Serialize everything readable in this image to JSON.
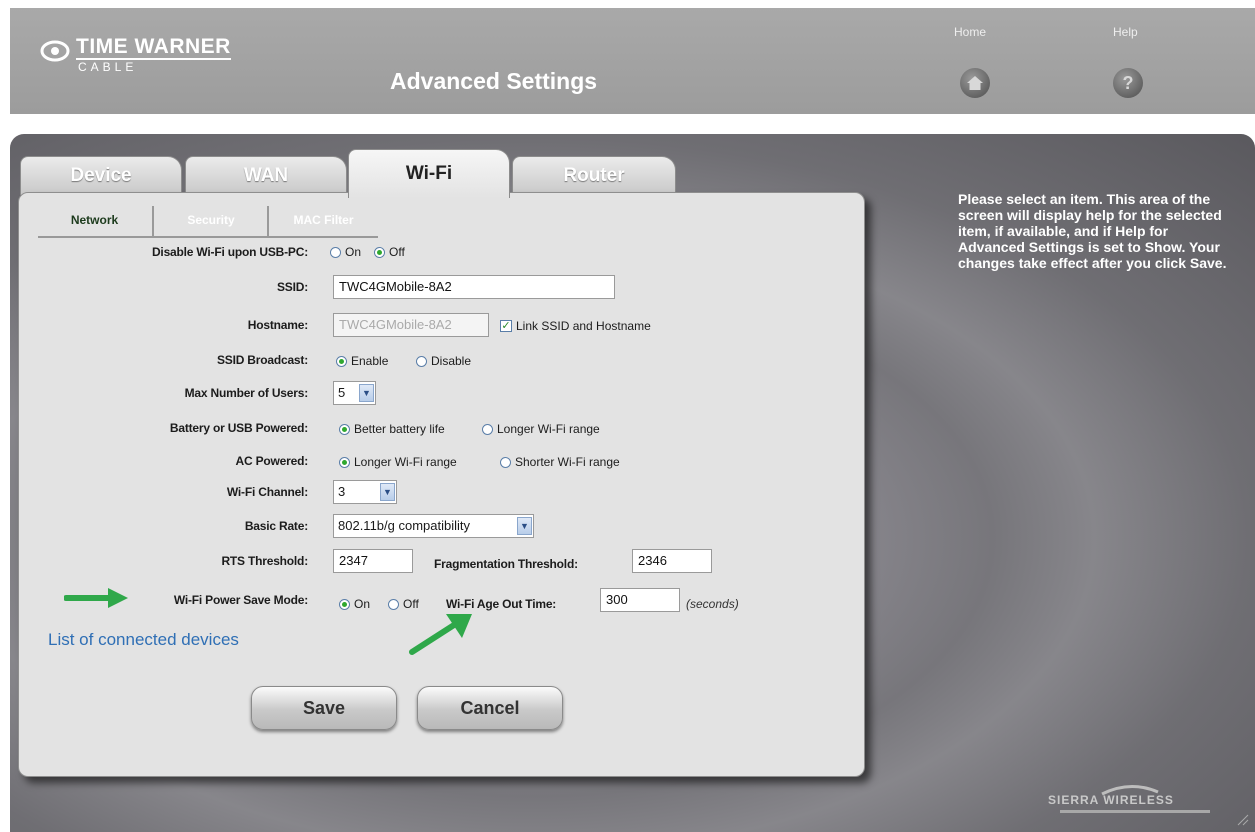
{
  "header": {
    "logo_line1": "TIME WARNER",
    "logo_line2": "CABLE",
    "title": "Advanced Settings",
    "home_label": "Home",
    "help_label": "Help",
    "home_icon": "house-icon",
    "help_icon": "question-icon"
  },
  "tabs": [
    {
      "label": "Device",
      "active": false
    },
    {
      "label": "WAN",
      "active": false
    },
    {
      "label": "Wi-Fi",
      "active": true
    },
    {
      "label": "Router",
      "active": false
    }
  ],
  "subtabs": [
    {
      "label": "Network",
      "active": true
    },
    {
      "label": "Security",
      "active": false
    },
    {
      "label": "MAC Filter",
      "active": false
    }
  ],
  "form": {
    "disable_wifi": {
      "label": "Disable Wi-Fi upon USB-PC:",
      "options": [
        "On",
        "Off"
      ],
      "selected": "Off"
    },
    "ssid": {
      "label": "SSID:",
      "value": "TWC4GMobile-8A2"
    },
    "hostname": {
      "label": "Hostname:",
      "value": "TWC4GMobile-8A2",
      "link_label": "Link SSID and Hostname",
      "link_checked": true
    },
    "ssid_broadcast": {
      "label": "SSID Broadcast:",
      "options": [
        "Enable",
        "Disable"
      ],
      "selected": "Enable"
    },
    "max_users": {
      "label": "Max Number of Users:",
      "value": "5"
    },
    "battery": {
      "label": "Battery or USB Powered:",
      "options": [
        "Better battery life",
        "Longer Wi-Fi range"
      ],
      "selected": "Better battery life"
    },
    "ac_powered": {
      "label": "AC Powered:",
      "options": [
        "Longer Wi-Fi range",
        "Shorter Wi-Fi range"
      ],
      "selected": "Longer Wi-Fi range"
    },
    "channel": {
      "label": "Wi-Fi Channel:",
      "value": "3"
    },
    "basic_rate": {
      "label": "Basic Rate:",
      "value": "802.11b/g compatibility"
    },
    "rts": {
      "label": "RTS Threshold:",
      "value": "2347"
    },
    "frag": {
      "label": "Fragmentation Threshold:",
      "value": "2346"
    },
    "power_save": {
      "label": "Wi-Fi Power Save Mode:",
      "options": [
        "On",
        "Off"
      ],
      "selected": "On"
    },
    "age_out": {
      "label": "Wi-Fi Age Out Time:",
      "value": "300",
      "unit": "(seconds)"
    }
  },
  "connected_link": "List of connected devices",
  "buttons": {
    "save": "Save",
    "cancel": "Cancel"
  },
  "help_text": "Please select an item. This area of the screen will display help for the selected item, if available, and if Help for Advanced Settings is set to Show. Your changes take effect after you click Save.",
  "footer_brand": "SIERRA WIRELESS",
  "colors": {
    "arrow": "#2fa84a",
    "link": "#2f6fb5"
  }
}
